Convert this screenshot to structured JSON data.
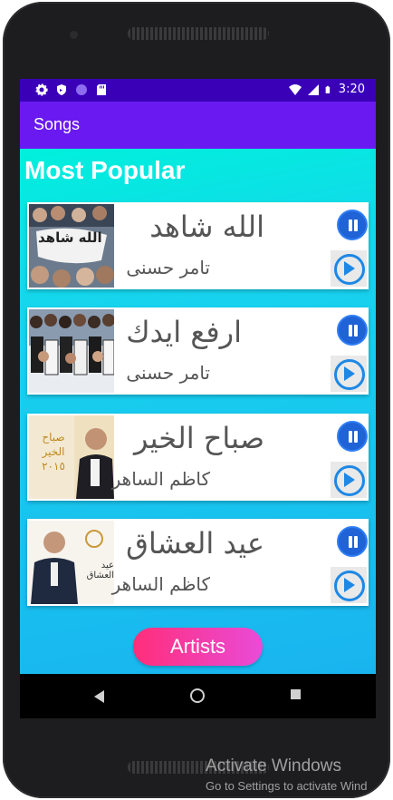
{
  "status_bar": {
    "time": "3:20",
    "left_icons": [
      "gear-icon",
      "shield-icon",
      "circle-icon",
      "sd-card-icon"
    ],
    "right_icons": [
      "wifi-icon",
      "signal-icon",
      "battery-icon"
    ]
  },
  "app_bar": {
    "title": "Songs"
  },
  "section": {
    "title": "Most Popular"
  },
  "songs": [
    {
      "title": "الله شاهد",
      "artist": "تامر حسنى",
      "thumb_text": "الله شاهد"
    },
    {
      "title": "ارفع ايدك",
      "artist": "تامر حسنى",
      "thumb_text": ""
    },
    {
      "title": "صباح الخير",
      "artist": "كاظم الساهر",
      "thumb_text": "صباح الخير ٢٠١٥"
    },
    {
      "title": "عيد العشاق",
      "artist": "كاظم الساهر",
      "thumb_text": "عيد العشاق"
    }
  ],
  "artists_button": {
    "label": "Artists"
  },
  "nav": {
    "icons": [
      "back-icon",
      "home-icon",
      "recents-icon"
    ]
  },
  "watermark": {
    "line1": "Activate Windows",
    "line2": "Go to Settings to activate Wind"
  },
  "colors": {
    "status_bar": "#3a00b8",
    "app_bar": "#6a1af0",
    "gradient_top": "#00f0dc",
    "gradient_bottom": "#19b4ef",
    "accent_blue": "#1e88e5",
    "artists_button": "#ff2e7a"
  }
}
